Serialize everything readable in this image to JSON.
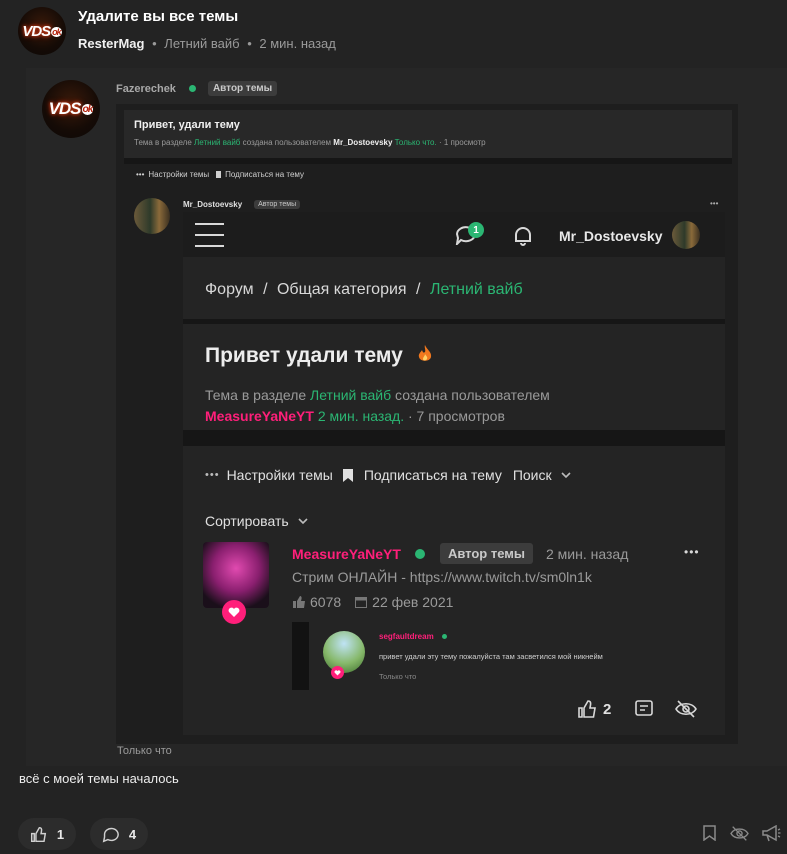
{
  "thread": {
    "title": "Удалите вы все темы",
    "author": "ResterMag",
    "sep1": "•",
    "category": "Летний вайб",
    "sep2": "•",
    "time": "2 мин. назад"
  },
  "post": {
    "author": "Fazerechek",
    "author_badge": "Автор темы",
    "avatar_text": "VDS",
    "avatar_badge": "ok",
    "time": "Только что",
    "text": "всё с моей темы началось",
    "like_count": "1",
    "comment_count": "4"
  },
  "shot1": {
    "title": "Привет, удали тему",
    "meta_prefix": "Тема в разделе",
    "meta_category": "Летний вайб",
    "meta_mid": "создана пользователем",
    "meta_user": "Mr_Dostoevsky",
    "meta_time": "Только что.",
    "meta_views": "· 1 просмотр",
    "actions_dots": "•••",
    "settings": "Настройки темы",
    "subscribe": "Подписаться на тему",
    "author": "Mr_Dostoevsky",
    "author_badge": "Автор темы",
    "more": "•••"
  },
  "shot2": {
    "header_user": "Mr_Dostoevsky",
    "notif_count": "1",
    "breadcrumb": [
      "Форум",
      "/",
      "Общая категория",
      "/",
      "Летний вайб"
    ],
    "title": "Привет удали тему",
    "meta_prefix": "Тема в разделе",
    "meta_category": "Летний вайб",
    "meta_mid": "создана пользователем",
    "meta_user": "MeasureYaNeYT",
    "meta_time": "2 мин. назад.",
    "meta_views": "· 7 просмотров",
    "actions_dots": "•••",
    "settings": "Настройки темы",
    "subscribe": "Подписаться на тему",
    "search": "Поиск",
    "sort": "Сортировать",
    "author": "MeasureYaNeYT",
    "author_badge": "Автор темы",
    "time": "2 мин. назад",
    "more": "•••",
    "status": "Стрим ОНЛАЙН - https://www.twitch.tv/sm0ln1k",
    "likes": "6078",
    "date": "22 фев 2021",
    "reply_user": "segfaultdream",
    "reply_text": "привет удали эту тему пожалуйста там засветился мой никнейм",
    "reply_time": "Только что",
    "post_likes": "2"
  },
  "colors": {
    "accent_green": "#2bb673",
    "pink": "#ff1f7a",
    "bg": "#232323",
    "shot_bg": "#1c1c1c"
  }
}
